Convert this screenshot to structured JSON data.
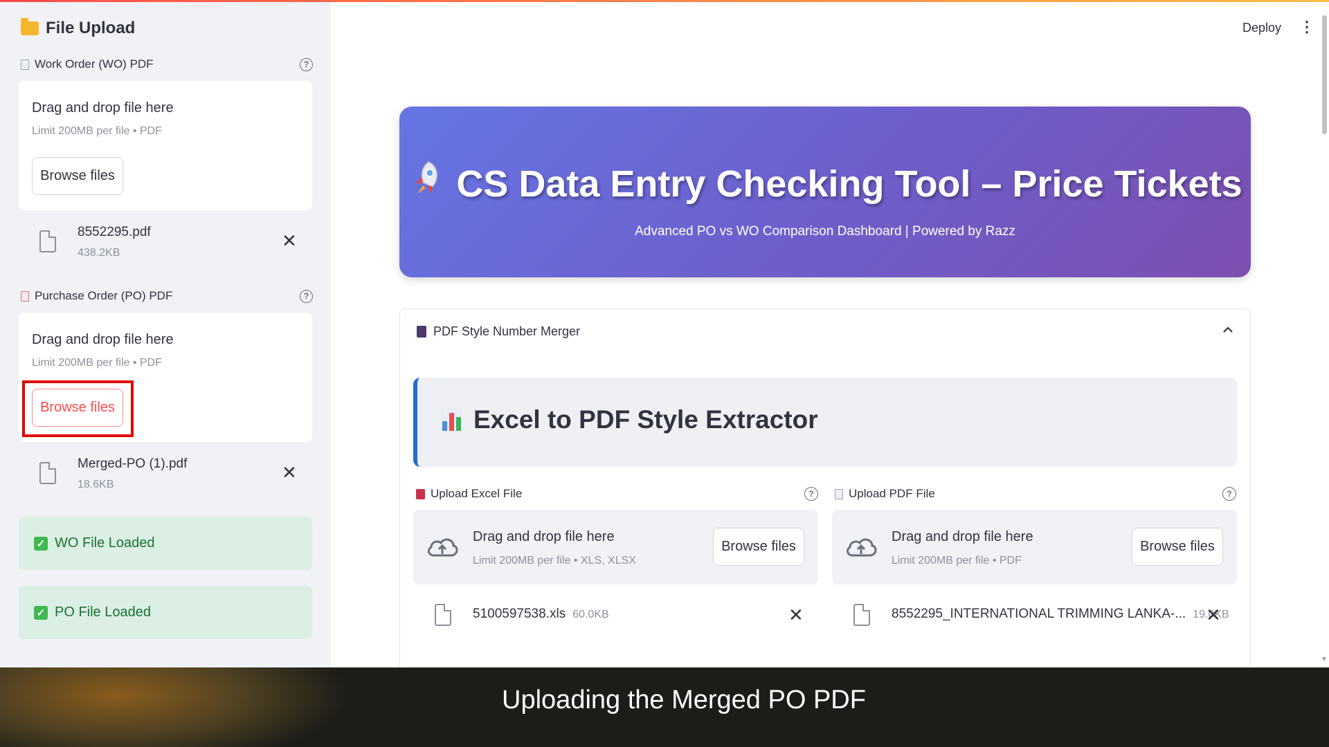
{
  "sidebar": {
    "title": "File Upload",
    "wo": {
      "label": "Work Order (WO) PDF",
      "drop_text": "Drag and drop file here",
      "limit_text": "Limit 200MB per file • PDF",
      "browse_label": "Browse files",
      "file_name": "8552295.pdf",
      "file_size": "438.2KB"
    },
    "po": {
      "label": "Purchase Order (PO) PDF",
      "drop_text": "Drag and drop file here",
      "limit_text": "Limit 200MB per file • PDF",
      "browse_label": "Browse files",
      "file_name": "Merged-PO (1).pdf",
      "file_size": "18.6KB"
    },
    "status": [
      {
        "text": "WO File Loaded"
      },
      {
        "text": "PO File Loaded"
      }
    ]
  },
  "header": {
    "deploy_label": "Deploy",
    "menu_icon": "kebab-menu-icon"
  },
  "hero": {
    "icon": "rocket-icon",
    "title": "CS Data Entry Checking Tool – Price Tickets",
    "subtitle": "Advanced PO vs WO Comparison Dashboard | Powered by Razz",
    "gradient_start": "#6576e4",
    "gradient_end": "#7c4fb0"
  },
  "expander": {
    "title": "PDF Style Number Merger",
    "banner_title": "Excel to PDF Style Extractor",
    "excel": {
      "label": "Upload Excel File",
      "drop_text": "Drag and drop file here",
      "limit_text": "Limit 200MB per file • XLS, XLSX",
      "browse_label": "Browse files",
      "file_name": "5100597538.xls",
      "file_size": "60.0KB"
    },
    "pdf": {
      "label": "Upload PDF File",
      "drop_text": "Drag and drop file here",
      "limit_text": "Limit 200MB per file • PDF",
      "browse_label": "Browse files",
      "file_name": "8552295_INTERNATIONAL TRIMMING LANKA-...",
      "file_size": "19.0KB"
    }
  },
  "caption": {
    "text": "Uploading the Merged PO PDF"
  },
  "colors": {
    "accent_red": "#ff4b4b",
    "success_bg": "#dcefe4",
    "success_text": "#177233",
    "highlight_box": "#e00000"
  }
}
